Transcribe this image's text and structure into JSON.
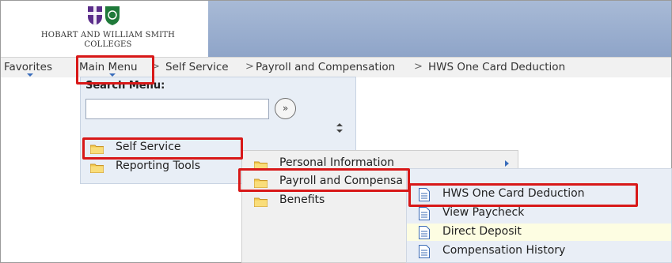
{
  "logo": {
    "institution_line1": "HOBART AND WILLIAM SMITH",
    "institution_line2": "COLLEGES"
  },
  "breadcrumb": {
    "items": [
      "Favorites",
      "Main Menu",
      "Self Service",
      "Payroll and Compensation",
      "HWS One Card Deduction"
    ],
    "separator": ">"
  },
  "main_menu": {
    "search_label": "Search Menu:",
    "search_value": "",
    "search_go_icon": "double-chevron-right-icon",
    "items": [
      "Self Service",
      "Reporting Tools"
    ]
  },
  "self_service_menu": {
    "items": [
      "Personal Information",
      "Payroll and Compensa",
      "Benefits"
    ]
  },
  "payroll_menu": {
    "items": [
      "HWS One Card Deduction",
      "View Paycheck",
      "Direct Deposit",
      "Compensation History"
    ]
  },
  "colors": {
    "highlight_red": "#d81818",
    "banner": "#9aaecf",
    "menu_bg": "#e8eef6",
    "hover_row": "#fdfde2"
  }
}
